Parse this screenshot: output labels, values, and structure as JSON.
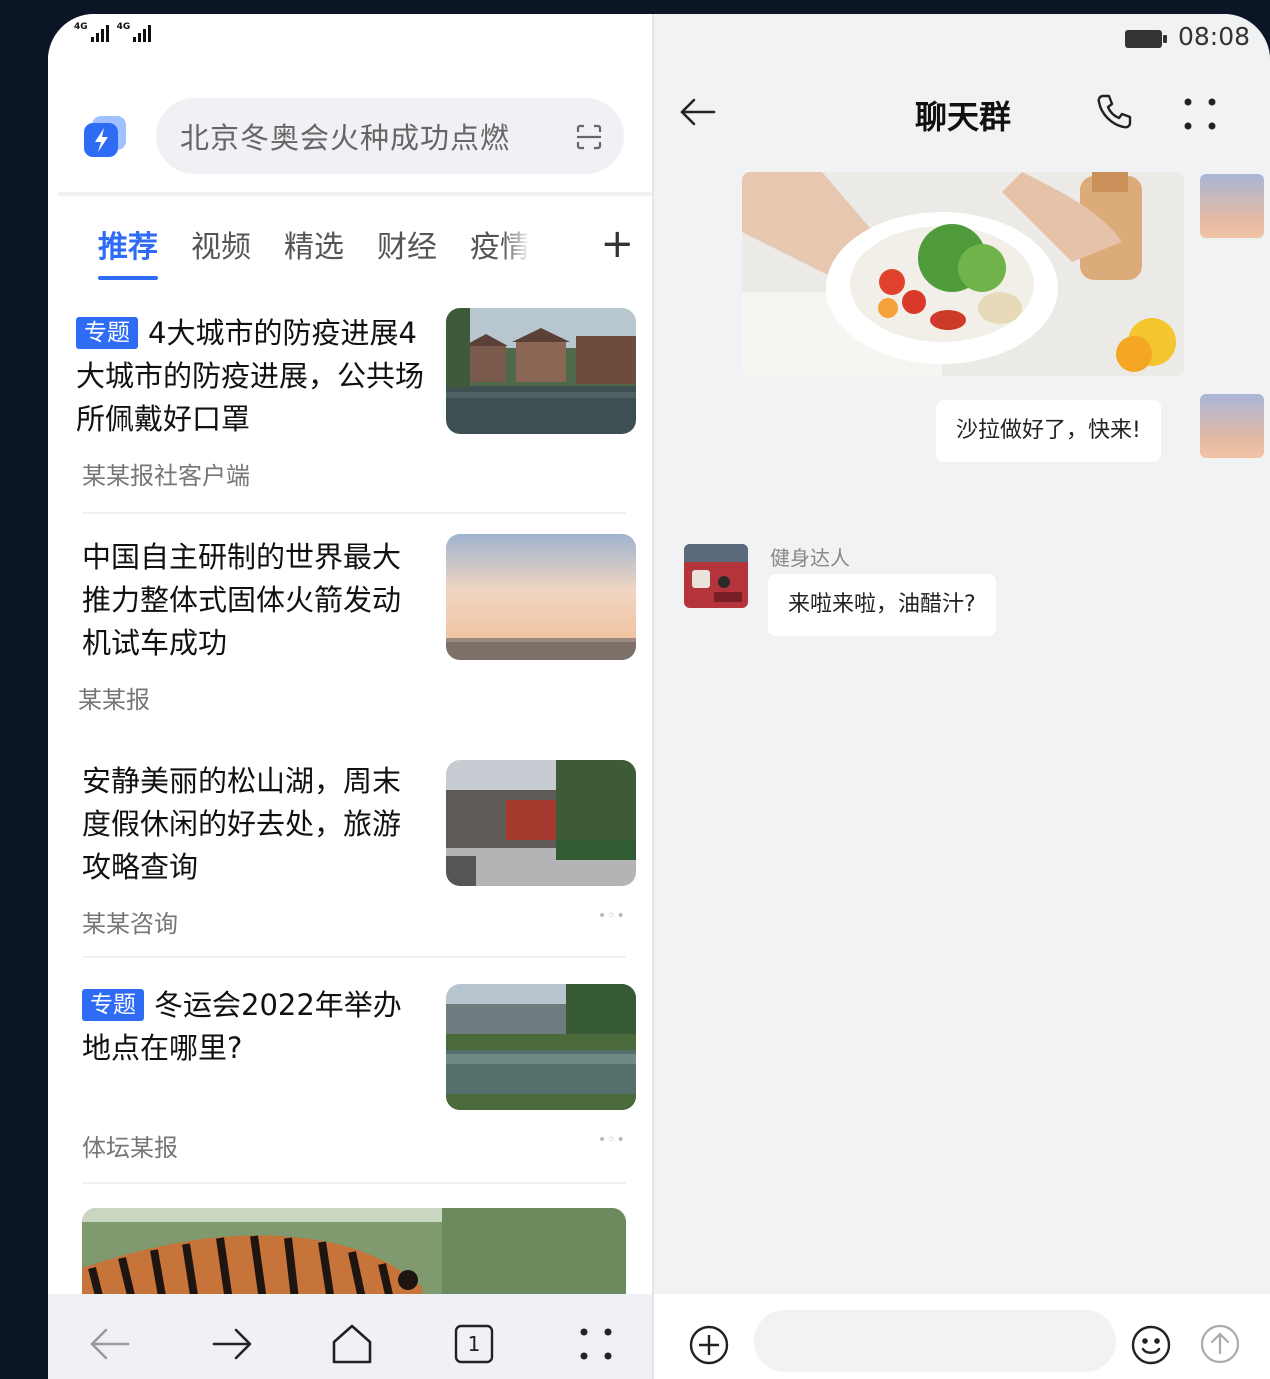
{
  "status": {
    "network": [
      "4G",
      "4G"
    ],
    "time": "08:08"
  },
  "browser": {
    "search_text": "北京冬奥会火种成功点燃",
    "tabs": [
      "推荐",
      "视频",
      "精选",
      "财经",
      "疫情"
    ],
    "active_tab": "推荐",
    "news": [
      {
        "badge": "专题",
        "title": "4大城市的防疫进展4大城市的防疫进展，公共场所佩戴好口罩",
        "source": "某某报社客户端"
      },
      {
        "badge": "",
        "title": "中国自主研制的世界最大推力整体式固体火箭发动机试车成功",
        "source": "某某报"
      },
      {
        "badge": "",
        "title": "安静美丽的松山湖，周末度假休闲的好去处，旅游攻略查询",
        "source": "某某咨询"
      },
      {
        "badge": "专题",
        "title": "冬运会2022年举办地点在哪里?",
        "source": "体坛某报"
      }
    ],
    "tab_count": "1"
  },
  "chat": {
    "title": "聊天群",
    "my_message": "沙拉做好了，快来!",
    "other_sender": "健身达人",
    "other_message": "来啦来啦，油醋汁?",
    "input_placeholder": ""
  },
  "colors": {
    "accent": "#2f6cf6",
    "chat_background": "#f1f2f4",
    "frame": "#0b1526"
  }
}
